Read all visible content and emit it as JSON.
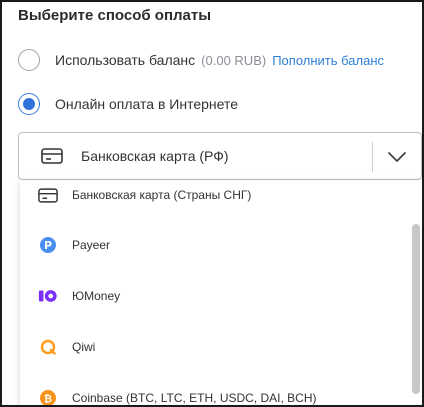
{
  "section": {
    "title": "Выберите способ оплаты"
  },
  "balance_option": {
    "label": "Использовать баланс",
    "amount": "(0.00 RUB)",
    "topup_link": "Пополнить баланс"
  },
  "online_option": {
    "label": "Онлайн оплата в Интернете"
  },
  "payment_select": {
    "selected": "Банковская карта (РФ)"
  },
  "dropdown_options": [
    {
      "label": "Банковская карта (Страны СНГ)",
      "icon": "card-icon"
    },
    {
      "label": "Payeer",
      "icon": "payeer-icon"
    },
    {
      "label": "ЮMoney",
      "icon": "yoomoney-icon"
    },
    {
      "label": "Qiwi",
      "icon": "qiwi-icon"
    },
    {
      "label": "Coinbase (BTC, LTC, ETH, USDC, DAI, BCH)",
      "icon": "coinbase-icon"
    }
  ],
  "colors": {
    "accent": "#2f72dc",
    "link": "#2f7fd6",
    "yoomoney": "#7b2ff7",
    "qiwi": "#ff9c1a",
    "coinbase": "#f7931a"
  }
}
